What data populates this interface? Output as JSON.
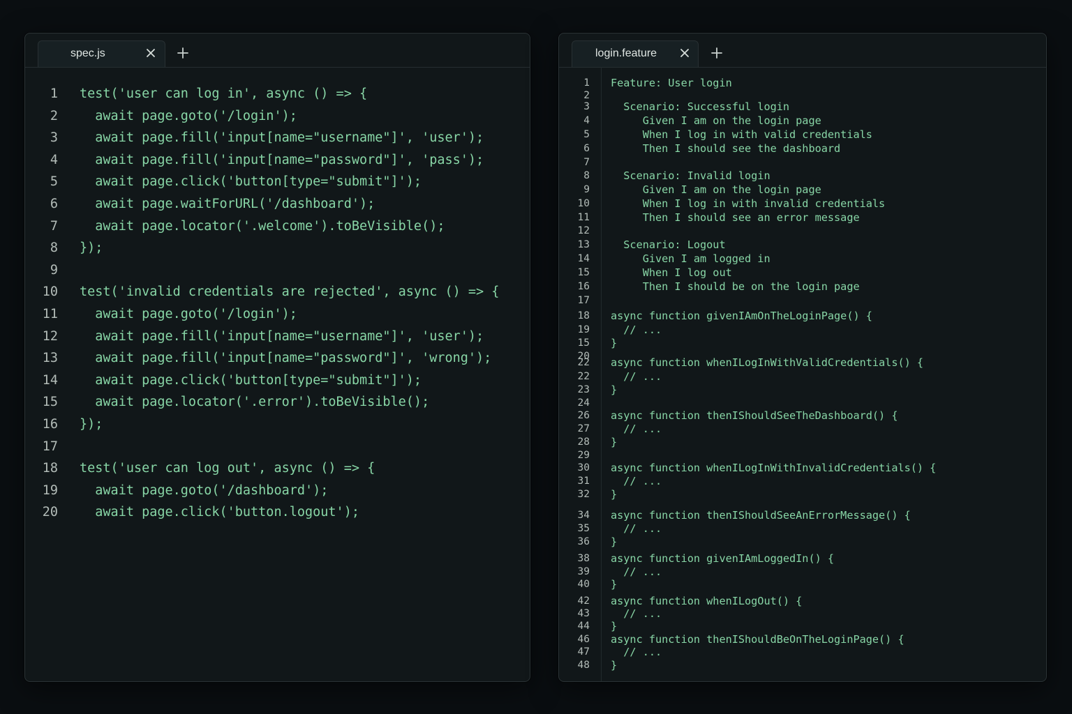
{
  "colors": {
    "background": "#0a0e11",
    "panel": "#111719",
    "code_text": "#88d6a6",
    "line_number": "#b3bcb8",
    "tab_label": "#dfe6e3"
  },
  "left_editor": {
    "tab": {
      "label": "spec.js",
      "close_icon": "close-icon"
    },
    "add_tab_icon": "plus-icon",
    "lines": [
      {
        "n": "1",
        "text": "test('user can log in', async () => {"
      },
      {
        "n": "2",
        "text": "  await page.goto('/login');"
      },
      {
        "n": "3",
        "text": "  await page.fill('input[name=\"username\"]', 'user');"
      },
      {
        "n": "4",
        "text": "  await page.fill('input[name=\"password\"]', 'pass');"
      },
      {
        "n": "5",
        "text": "  await page.click('button[type=\"submit\"]');"
      },
      {
        "n": "6",
        "text": "  await page.waitForURL('/dashboard');"
      },
      {
        "n": "7",
        "text": "  await page.locator('.welcome').toBeVisible();"
      },
      {
        "n": "8",
        "text": "});"
      },
      {
        "n": "9",
        "text": ""
      },
      {
        "n": "10",
        "text": "test('invalid credentials are rejected', async () => {"
      },
      {
        "n": "11",
        "text": "  await page.goto('/login');"
      },
      {
        "n": "12",
        "text": "  await page.fill('input[name=\"username\"]', 'user');"
      },
      {
        "n": "13",
        "text": "  await page.fill('input[name=\"password\"]', 'wrong');"
      },
      {
        "n": "14",
        "text": "  await page.click('button[type=\"submit\"]');"
      },
      {
        "n": "15",
        "text": "  await page.locator('.error').toBeVisible();"
      },
      {
        "n": "16",
        "text": "});"
      },
      {
        "n": "17",
        "text": ""
      },
      {
        "n": "18",
        "text": "test('user can log out', async () => {"
      },
      {
        "n": "19",
        "text": "  await page.goto('/dashboard');"
      },
      {
        "n": "20",
        "text": "  await page.click('button.logout');"
      }
    ]
  },
  "right_editor": {
    "tab": {
      "label": "login.feature",
      "close_icon": "close-icon"
    },
    "add_tab_icon": "plus-icon",
    "lines": [
      {
        "n": "1",
        "text": "Feature: User login"
      },
      {
        "n": "2",
        "text": ""
      },
      {
        "n": "3",
        "text": "  Scenario: Successful login"
      },
      {
        "n": "4",
        "text": "     Given I am on the login page"
      },
      {
        "n": "5",
        "text": "     When I log in with valid credentials"
      },
      {
        "n": "6",
        "text": "     Then I should see the dashboard"
      },
      {
        "n": "7",
        "text": ""
      },
      {
        "n": "8",
        "text": "  Scenario: Invalid login"
      },
      {
        "n": "9",
        "text": "     Given I am on the login page"
      },
      {
        "n": "10",
        "text": "     When I log in with invalid credentials"
      },
      {
        "n": "11",
        "text": "     Then I should see an error message"
      },
      {
        "n": "12",
        "text": ""
      },
      {
        "n": "13",
        "text": "  Scenario: Logout"
      },
      {
        "n": "14",
        "text": "     Given I am logged in"
      },
      {
        "n": "15",
        "text": "     When I log out"
      },
      {
        "n": "16",
        "text": "     Then I should be on the login page"
      },
      {
        "n": "17",
        "text": ""
      },
      {
        "n": "18",
        "text": "async function givenIAmOnTheLoginPage() {"
      },
      {
        "n": "19",
        "text": "  // ..."
      },
      {
        "n": "15",
        "text": "}"
      },
      {
        "n": "20",
        "text": ""
      },
      {
        "n": "22",
        "text": "async function whenILogInWithValidCredentials() {"
      },
      {
        "n": "22",
        "text": "  // ..."
      },
      {
        "n": "23",
        "text": "}"
      },
      {
        "n": "24",
        "text": ""
      },
      {
        "n": "26",
        "text": "async function thenIShouldSeeTheDashboard() {"
      },
      {
        "n": "27",
        "text": "  // ..."
      },
      {
        "n": "28",
        "text": "}"
      },
      {
        "n": "29",
        "text": ""
      },
      {
        "n": "30",
        "text": "async function whenILogInWithInvalidCredentials() {"
      },
      {
        "n": "31",
        "text": "  // ..."
      },
      {
        "n": "32",
        "text": "}"
      },
      {
        "n": "34",
        "text": "async function thenIShouldSeeAnErrorMessage() {"
      },
      {
        "n": "35",
        "text": "  // ..."
      },
      {
        "n": "36",
        "text": "}"
      },
      {
        "n": "38",
        "text": "async function givenIAmLoggedIn() {"
      },
      {
        "n": "39",
        "text": "  // ..."
      },
      {
        "n": "40",
        "text": "}"
      },
      {
        "n": "42",
        "text": "async function whenILogOut() {"
      },
      {
        "n": "43",
        "text": "  // ..."
      },
      {
        "n": "44",
        "text": "}"
      },
      {
        "n": "46",
        "text": "async function thenIShouldBeOnTheLoginPage() {"
      },
      {
        "n": "47",
        "text": "  // ..."
      },
      {
        "n": "48",
        "text": "}"
      }
    ]
  }
}
